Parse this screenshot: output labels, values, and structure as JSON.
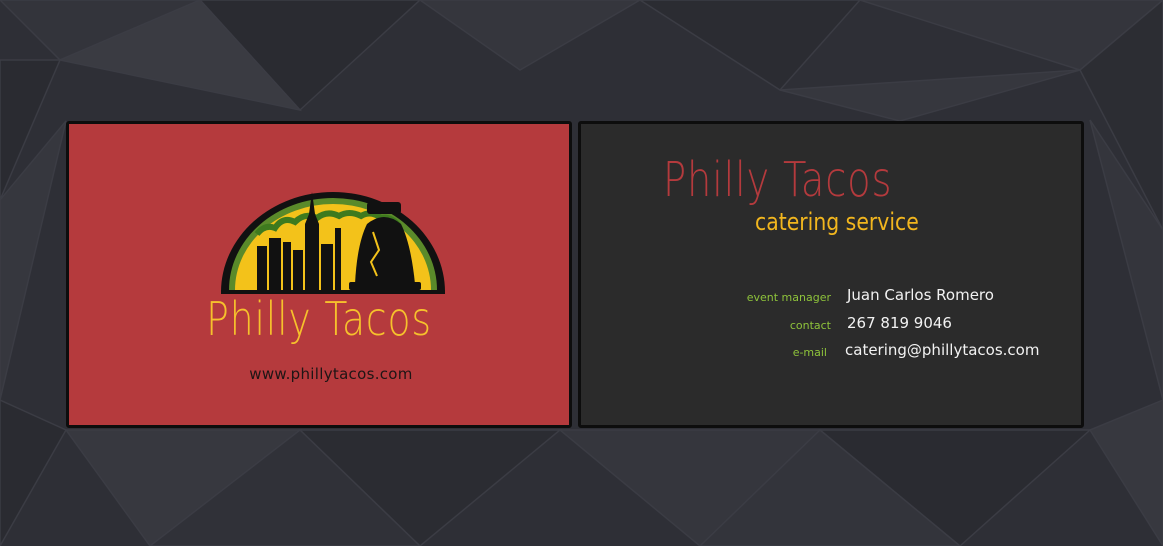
{
  "front": {
    "title": "Philly Tacos",
    "url": "www.phillytacos.com",
    "logo_icon": "taco-skyline-liberty-bell-logo"
  },
  "back": {
    "title": "Philly Tacos",
    "subtitle": "catering service",
    "rows": [
      {
        "label": "event manager",
        "value": "Juan Carlos Romero"
      },
      {
        "label": "contact",
        "value": "267 819 9046"
      },
      {
        "label": "e-mail",
        "value": "catering@phillytacos.com"
      }
    ]
  },
  "colors": {
    "background": "#2f3037",
    "front_card": "#b53a3d",
    "back_card": "#2b2b2b",
    "accent_yellow": "#f6c12c",
    "accent_red": "#b43a3d",
    "label_green": "#8ec33b"
  }
}
